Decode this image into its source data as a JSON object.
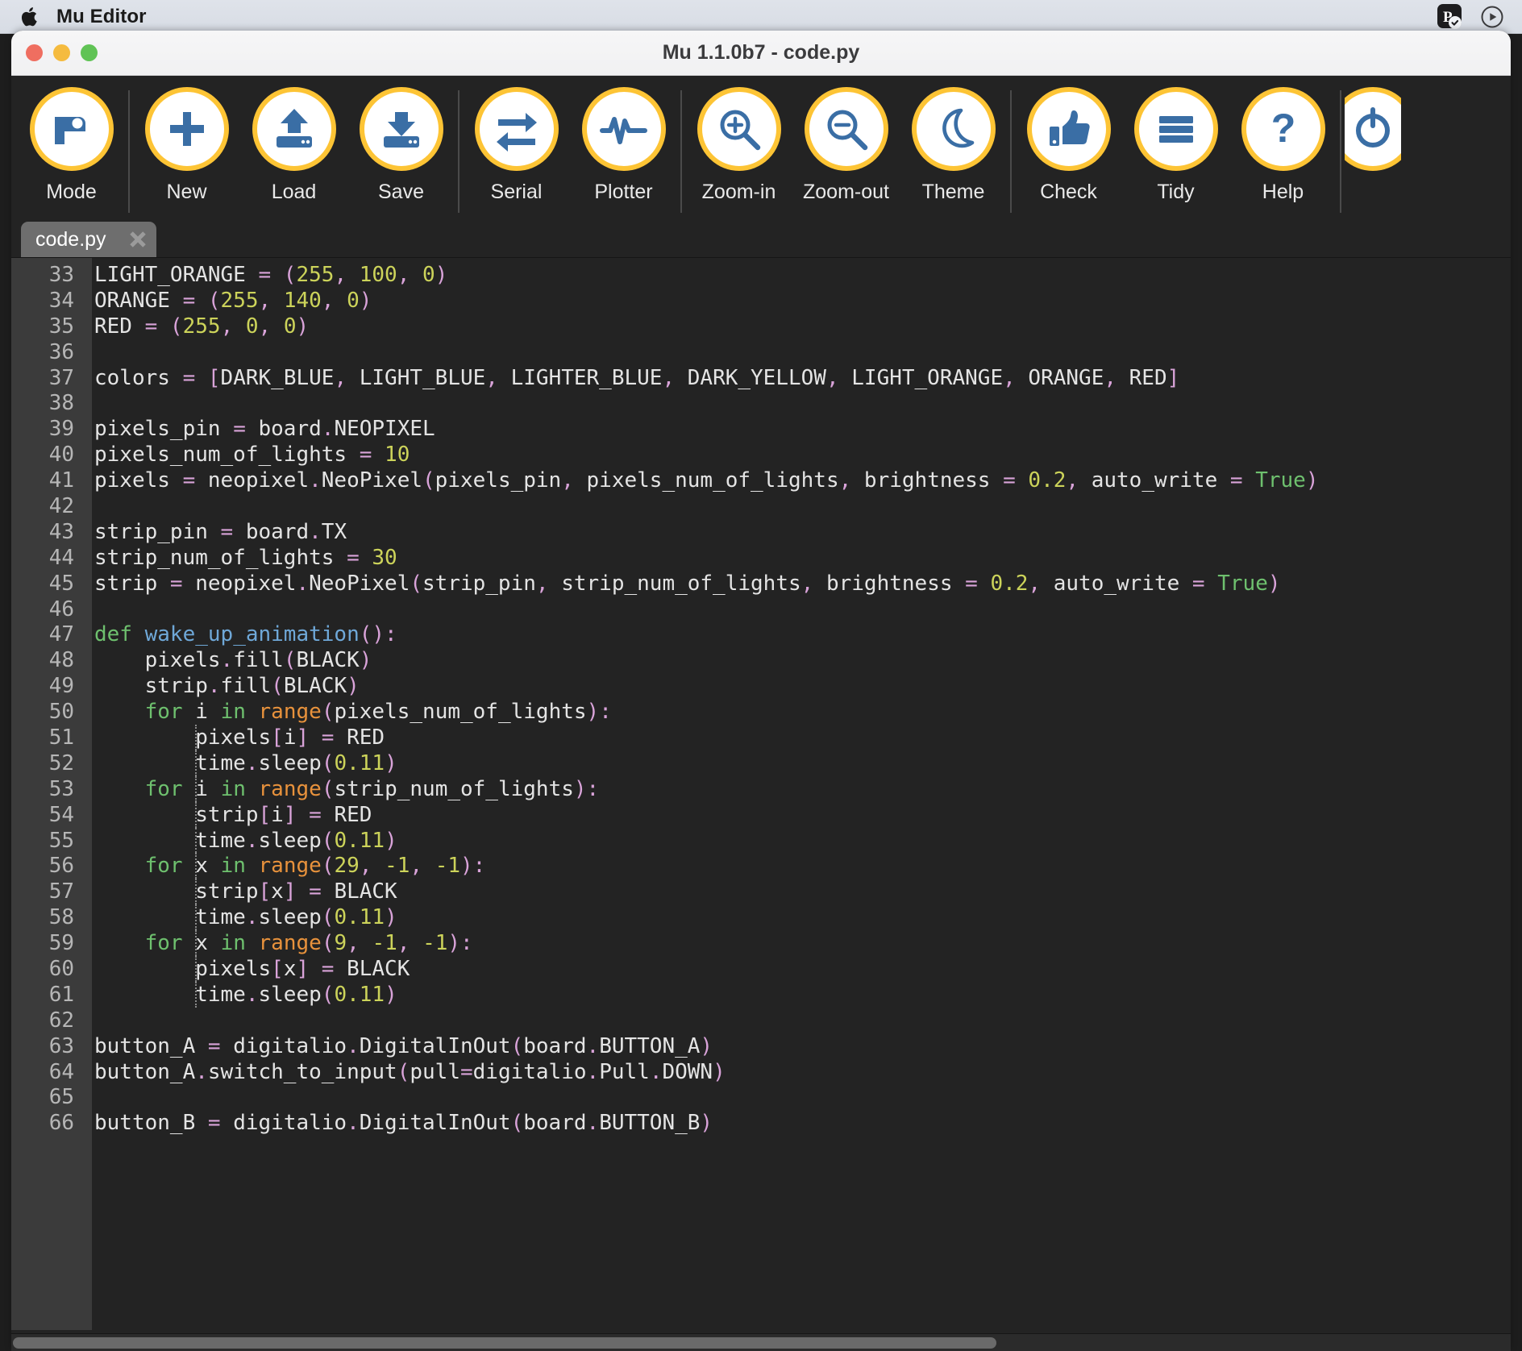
{
  "menubar": {
    "apple_icon": "apple-logo-icon",
    "app_title": "Mu Editor",
    "extras": [
      {
        "name": "pocket-casts-status-icon",
        "glyph": "P"
      },
      {
        "name": "control-center-play-icon",
        "glyph": "play"
      }
    ]
  },
  "window": {
    "title": "Mu 1.1.0b7 - code.py",
    "traffic_lights": {
      "close": "close",
      "minimize": "minimize",
      "maximize": "maximize"
    }
  },
  "toolbar": {
    "buttons": [
      {
        "label": "Mode",
        "icon": "mode-icon",
        "sep_after": true
      },
      {
        "label": "New",
        "icon": "new-file-icon",
        "sep_after": false
      },
      {
        "label": "Load",
        "icon": "load-icon",
        "sep_after": false
      },
      {
        "label": "Save",
        "icon": "save-icon",
        "sep_after": true
      },
      {
        "label": "Serial",
        "icon": "serial-icon",
        "sep_after": false
      },
      {
        "label": "Plotter",
        "icon": "plotter-icon",
        "sep_after": true
      },
      {
        "label": "Zoom-in",
        "icon": "zoom-in-icon",
        "sep_after": false
      },
      {
        "label": "Zoom-out",
        "icon": "zoom-out-icon",
        "sep_after": false
      },
      {
        "label": "Theme",
        "icon": "theme-moon-icon",
        "sep_after": true
      },
      {
        "label": "Check",
        "icon": "check-thumbsup-icon",
        "sep_after": false
      },
      {
        "label": "Tidy",
        "icon": "tidy-lines-icon",
        "sep_after": false
      },
      {
        "label": "Help",
        "icon": "help-question-icon",
        "sep_after": true
      },
      {
        "label": "",
        "icon": "quit-icon",
        "sep_after": false
      }
    ]
  },
  "tabs": [
    {
      "label": "code.py",
      "active": true,
      "close_icon": "close-tab-icon"
    }
  ],
  "editor": {
    "first_line_number": 33,
    "lines": [
      {
        "n": 33,
        "tokens": [
          [
            "id",
            "LIGHT_ORANGE "
          ],
          [
            "op",
            "= ("
          ],
          [
            "num",
            "255"
          ],
          [
            "op",
            ", "
          ],
          [
            "num",
            "100"
          ],
          [
            "op",
            ", "
          ],
          [
            "num",
            "0"
          ],
          [
            "op",
            ")"
          ]
        ]
      },
      {
        "n": 34,
        "tokens": [
          [
            "id",
            "ORANGE "
          ],
          [
            "op",
            "= ("
          ],
          [
            "num",
            "255"
          ],
          [
            "op",
            ", "
          ],
          [
            "num",
            "140"
          ],
          [
            "op",
            ", "
          ],
          [
            "num",
            "0"
          ],
          [
            "op",
            ")"
          ]
        ]
      },
      {
        "n": 35,
        "tokens": [
          [
            "id",
            "RED "
          ],
          [
            "op",
            "= ("
          ],
          [
            "num",
            "255"
          ],
          [
            "op",
            ", "
          ],
          [
            "num",
            "0"
          ],
          [
            "op",
            ", "
          ],
          [
            "num",
            "0"
          ],
          [
            "op",
            ")"
          ]
        ]
      },
      {
        "n": 36,
        "tokens": []
      },
      {
        "n": 37,
        "tokens": [
          [
            "id",
            "colors "
          ],
          [
            "op",
            "= ["
          ],
          [
            "id",
            "DARK_BLUE"
          ],
          [
            "op",
            ", "
          ],
          [
            "id",
            "LIGHT_BLUE"
          ],
          [
            "op",
            ", "
          ],
          [
            "id",
            "LIGHTER_BLUE"
          ],
          [
            "op",
            ", "
          ],
          [
            "id",
            "DARK_YELLOW"
          ],
          [
            "op",
            ", "
          ],
          [
            "id",
            "LIGHT_ORANGE"
          ],
          [
            "op",
            ", "
          ],
          [
            "id",
            "ORANGE"
          ],
          [
            "op",
            ", "
          ],
          [
            "id",
            "RED"
          ],
          [
            "op",
            "]"
          ]
        ]
      },
      {
        "n": 38,
        "tokens": []
      },
      {
        "n": 39,
        "tokens": [
          [
            "id",
            "pixels_pin "
          ],
          [
            "op",
            "= "
          ],
          [
            "id",
            "board"
          ],
          [
            "op",
            "."
          ],
          [
            "id",
            "NEOPIXEL"
          ]
        ]
      },
      {
        "n": 40,
        "tokens": [
          [
            "id",
            "pixels_num_of_lights "
          ],
          [
            "op",
            "= "
          ],
          [
            "num",
            "10"
          ]
        ]
      },
      {
        "n": 41,
        "tokens": [
          [
            "id",
            "pixels "
          ],
          [
            "op",
            "= "
          ],
          [
            "id",
            "neopixel"
          ],
          [
            "op",
            "."
          ],
          [
            "id",
            "NeoPixel"
          ],
          [
            "op",
            "("
          ],
          [
            "id",
            "pixels_pin"
          ],
          [
            "op",
            ", "
          ],
          [
            "id",
            "pixels_num_of_lights"
          ],
          [
            "op",
            ", "
          ],
          [
            "id",
            "brightness "
          ],
          [
            "op",
            "= "
          ],
          [
            "num",
            "0.2"
          ],
          [
            "op",
            ", "
          ],
          [
            "id",
            "auto_write "
          ],
          [
            "op",
            "= "
          ],
          [
            "kw",
            "True"
          ],
          [
            "op",
            ")"
          ]
        ]
      },
      {
        "n": 42,
        "tokens": []
      },
      {
        "n": 43,
        "tokens": [
          [
            "id",
            "strip_pin "
          ],
          [
            "op",
            "= "
          ],
          [
            "id",
            "board"
          ],
          [
            "op",
            "."
          ],
          [
            "id",
            "TX"
          ]
        ]
      },
      {
        "n": 44,
        "tokens": [
          [
            "id",
            "strip_num_of_lights "
          ],
          [
            "op",
            "= "
          ],
          [
            "num",
            "30"
          ]
        ]
      },
      {
        "n": 45,
        "tokens": [
          [
            "id",
            "strip "
          ],
          [
            "op",
            "= "
          ],
          [
            "id",
            "neopixel"
          ],
          [
            "op",
            "."
          ],
          [
            "id",
            "NeoPixel"
          ],
          [
            "op",
            "("
          ],
          [
            "id",
            "strip_pin"
          ],
          [
            "op",
            ", "
          ],
          [
            "id",
            "strip_num_of_lights"
          ],
          [
            "op",
            ", "
          ],
          [
            "id",
            "brightness "
          ],
          [
            "op",
            "= "
          ],
          [
            "num",
            "0.2"
          ],
          [
            "op",
            ", "
          ],
          [
            "id",
            "auto_write "
          ],
          [
            "op",
            "= "
          ],
          [
            "kw",
            "True"
          ],
          [
            "op",
            ")"
          ]
        ]
      },
      {
        "n": 46,
        "tokens": []
      },
      {
        "n": 47,
        "tokens": [
          [
            "kw",
            "def "
          ],
          [
            "fn",
            "wake_up_animation"
          ],
          [
            "op",
            "():"
          ]
        ]
      },
      {
        "n": 48,
        "tokens": [
          [
            "id",
            "    pixels"
          ],
          [
            "op",
            "."
          ],
          [
            "id",
            "fill"
          ],
          [
            "op",
            "("
          ],
          [
            "id",
            "BLACK"
          ],
          [
            "op",
            ")"
          ]
        ]
      },
      {
        "n": 49,
        "tokens": [
          [
            "id",
            "    strip"
          ],
          [
            "op",
            "."
          ],
          [
            "id",
            "fill"
          ],
          [
            "op",
            "("
          ],
          [
            "id",
            "BLACK"
          ],
          [
            "op",
            ")"
          ]
        ]
      },
      {
        "n": 50,
        "tokens": [
          [
            "id",
            "    "
          ],
          [
            "kw",
            "for "
          ],
          [
            "id",
            "i "
          ],
          [
            "kw",
            "in "
          ],
          [
            "bi",
            "range"
          ],
          [
            "op",
            "("
          ],
          [
            "id",
            "pixels_num_of_lights"
          ],
          [
            "op",
            "):"
          ]
        ]
      },
      {
        "n": 51,
        "tokens": [
          [
            "id",
            "        pixels"
          ],
          [
            "op",
            "["
          ],
          [
            "id",
            "i"
          ],
          [
            "op",
            "] = "
          ],
          [
            "id",
            "RED"
          ]
        ]
      },
      {
        "n": 52,
        "tokens": [
          [
            "id",
            "        time"
          ],
          [
            "op",
            "."
          ],
          [
            "id",
            "sleep"
          ],
          [
            "op",
            "("
          ],
          [
            "num",
            "0.11"
          ],
          [
            "op",
            ")"
          ]
        ]
      },
      {
        "n": 53,
        "tokens": [
          [
            "id",
            "    "
          ],
          [
            "kw",
            "for "
          ],
          [
            "id",
            "i "
          ],
          [
            "kw",
            "in "
          ],
          [
            "bi",
            "range"
          ],
          [
            "op",
            "("
          ],
          [
            "id",
            "strip_num_of_lights"
          ],
          [
            "op",
            "):"
          ]
        ]
      },
      {
        "n": 54,
        "tokens": [
          [
            "id",
            "        strip"
          ],
          [
            "op",
            "["
          ],
          [
            "id",
            "i"
          ],
          [
            "op",
            "] = "
          ],
          [
            "id",
            "RED"
          ]
        ]
      },
      {
        "n": 55,
        "tokens": [
          [
            "id",
            "        time"
          ],
          [
            "op",
            "."
          ],
          [
            "id",
            "sleep"
          ],
          [
            "op",
            "("
          ],
          [
            "num",
            "0.11"
          ],
          [
            "op",
            ")"
          ]
        ]
      },
      {
        "n": 56,
        "tokens": [
          [
            "id",
            "    "
          ],
          [
            "kw",
            "for "
          ],
          [
            "id",
            "x "
          ],
          [
            "kw",
            "in "
          ],
          [
            "bi",
            "range"
          ],
          [
            "op",
            "("
          ],
          [
            "num",
            "29"
          ],
          [
            "op",
            ", "
          ],
          [
            "num",
            "-1"
          ],
          [
            "op",
            ", "
          ],
          [
            "num",
            "-1"
          ],
          [
            "op",
            "):"
          ]
        ]
      },
      {
        "n": 57,
        "tokens": [
          [
            "id",
            "        strip"
          ],
          [
            "op",
            "["
          ],
          [
            "id",
            "x"
          ],
          [
            "op",
            "] = "
          ],
          [
            "id",
            "BLACK"
          ]
        ]
      },
      {
        "n": 58,
        "tokens": [
          [
            "id",
            "        time"
          ],
          [
            "op",
            "."
          ],
          [
            "id",
            "sleep"
          ],
          [
            "op",
            "("
          ],
          [
            "num",
            "0.11"
          ],
          [
            "op",
            ")"
          ]
        ]
      },
      {
        "n": 59,
        "tokens": [
          [
            "id",
            "    "
          ],
          [
            "kw",
            "for "
          ],
          [
            "id",
            "x "
          ],
          [
            "kw",
            "in "
          ],
          [
            "bi",
            "range"
          ],
          [
            "op",
            "("
          ],
          [
            "num",
            "9"
          ],
          [
            "op",
            ", "
          ],
          [
            "num",
            "-1"
          ],
          [
            "op",
            ", "
          ],
          [
            "num",
            "-1"
          ],
          [
            "op",
            "):"
          ]
        ]
      },
      {
        "n": 60,
        "tokens": [
          [
            "id",
            "        pixels"
          ],
          [
            "op",
            "["
          ],
          [
            "id",
            "x"
          ],
          [
            "op",
            "] = "
          ],
          [
            "id",
            "BLACK"
          ]
        ]
      },
      {
        "n": 61,
        "tokens": [
          [
            "id",
            "        time"
          ],
          [
            "op",
            "."
          ],
          [
            "id",
            "sleep"
          ],
          [
            "op",
            "("
          ],
          [
            "num",
            "0.11"
          ],
          [
            "op",
            ")"
          ]
        ]
      },
      {
        "n": 62,
        "tokens": []
      },
      {
        "n": 63,
        "tokens": [
          [
            "id",
            "button_A "
          ],
          [
            "op",
            "= "
          ],
          [
            "id",
            "digitalio"
          ],
          [
            "op",
            "."
          ],
          [
            "id",
            "DigitalInOut"
          ],
          [
            "op",
            "("
          ],
          [
            "id",
            "board"
          ],
          [
            "op",
            "."
          ],
          [
            "id",
            "BUTTON_A"
          ],
          [
            "op",
            ")"
          ]
        ]
      },
      {
        "n": 64,
        "tokens": [
          [
            "id",
            "button_A"
          ],
          [
            "op",
            "."
          ],
          [
            "id",
            "switch_to_input"
          ],
          [
            "op",
            "("
          ],
          [
            "id",
            "pull"
          ],
          [
            "op",
            "="
          ],
          [
            "id",
            "digitalio"
          ],
          [
            "op",
            "."
          ],
          [
            "id",
            "Pull"
          ],
          [
            "op",
            "."
          ],
          [
            "id",
            "DOWN"
          ],
          [
            "op",
            ")"
          ]
        ]
      },
      {
        "n": 65,
        "tokens": []
      },
      {
        "n": 66,
        "tokens": [
          [
            "id",
            "button_B "
          ],
          [
            "op",
            "= "
          ],
          [
            "id",
            "digitalio"
          ],
          [
            "op",
            "."
          ],
          [
            "id",
            "DigitalInOut"
          ],
          [
            "op",
            "("
          ],
          [
            "id",
            "board"
          ],
          [
            "op",
            "."
          ],
          [
            "id",
            "BUTTON_B"
          ],
          [
            "op",
            ")"
          ]
        ]
      }
    ],
    "indent_guides": [
      {
        "line_index": 18,
        "cols": [
          8
        ]
      },
      {
        "line_index": 19,
        "cols": [
          8
        ]
      },
      {
        "line_index": 20,
        "cols": [
          8
        ]
      },
      {
        "line_index": 21,
        "cols": [
          8
        ]
      },
      {
        "line_index": 22,
        "cols": [
          8
        ]
      },
      {
        "line_index": 23,
        "cols": [
          8
        ]
      },
      {
        "line_index": 24,
        "cols": [
          8
        ]
      },
      {
        "line_index": 25,
        "cols": [
          8
        ]
      },
      {
        "line_index": 26,
        "cols": [
          8
        ]
      },
      {
        "line_index": 27,
        "cols": [
          8
        ]
      },
      {
        "line_index": 28,
        "cols": [
          8
        ]
      }
    ]
  },
  "colors": {
    "toolbar_bg": "#232323",
    "editor_bg": "#232323",
    "gutter_bg": "#3b3b3b",
    "icon_ring": "#fdc435",
    "icon_blue": "#3a6ea5",
    "keyword_green": "#6ec06e",
    "function_blue": "#6fa8d8",
    "builtin_orange": "#e8923c",
    "number_yellow": "#ccd35a",
    "operator_pink": "#d9a3d9",
    "tab_active_bg": "#6e6e6e"
  }
}
